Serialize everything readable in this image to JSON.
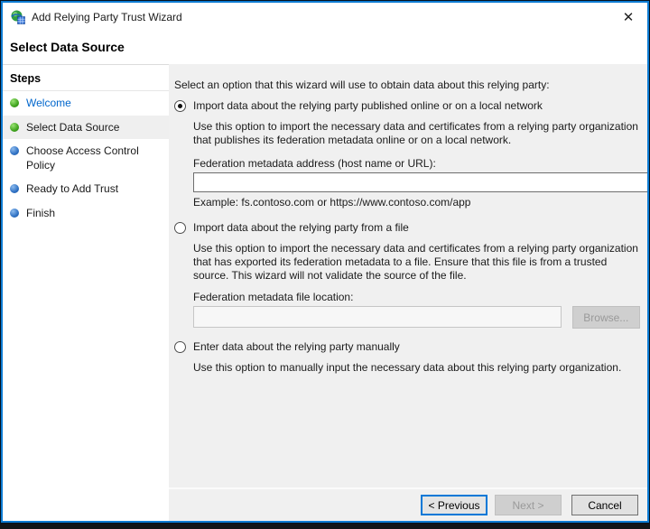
{
  "window": {
    "title": "Add Relying Party Trust Wizard",
    "close_glyph": "✕"
  },
  "page": {
    "heading": "Select Data Source"
  },
  "sidebar": {
    "title": "Steps",
    "items": [
      {
        "label": "Welcome",
        "state": "done",
        "current": false
      },
      {
        "label": "Select Data Source",
        "state": "done",
        "current": true
      },
      {
        "label": "Choose Access Control Policy",
        "state": "pending",
        "current": false
      },
      {
        "label": "Ready to Add Trust",
        "state": "pending",
        "current": false
      },
      {
        "label": "Finish",
        "state": "pending",
        "current": false
      }
    ]
  },
  "content": {
    "intro": "Select an option that this wizard will use to obtain data about this relying party:",
    "options": [
      {
        "label": "Import data about the relying party published online or on a local network",
        "selected": true,
        "description": "Use this option to import the necessary data and certificates from a relying party organization that publishes its federation metadata online or on a local network.",
        "field_label": "Federation metadata address (host name or URL):",
        "input_value": "",
        "example": "Example: fs.contoso.com or https://www.contoso.com/app"
      },
      {
        "label": "Import data about the relying party from a file",
        "selected": false,
        "description": "Use this option to import the necessary data and certificates from a relying party organization that has exported its federation metadata to a file. Ensure that this file is from a trusted source.  This wizard will not validate the source of the file.",
        "field_label": "Federation metadata file location:",
        "input_value": "",
        "browse_label": "Browse..."
      },
      {
        "label": "Enter data about the relying party manually",
        "selected": false,
        "description": "Use this option to manually input the necessary data about this relying party organization."
      }
    ]
  },
  "footer": {
    "previous": "< Previous",
    "next": "Next >",
    "cancel": "Cancel"
  },
  "colors": {
    "accent": "#0078d7",
    "step_done_bullet": "#3da21c",
    "step_pending_bullet": "#2d6fc2",
    "link_blue": "#0066cc",
    "content_bg": "#f0f0f0"
  }
}
